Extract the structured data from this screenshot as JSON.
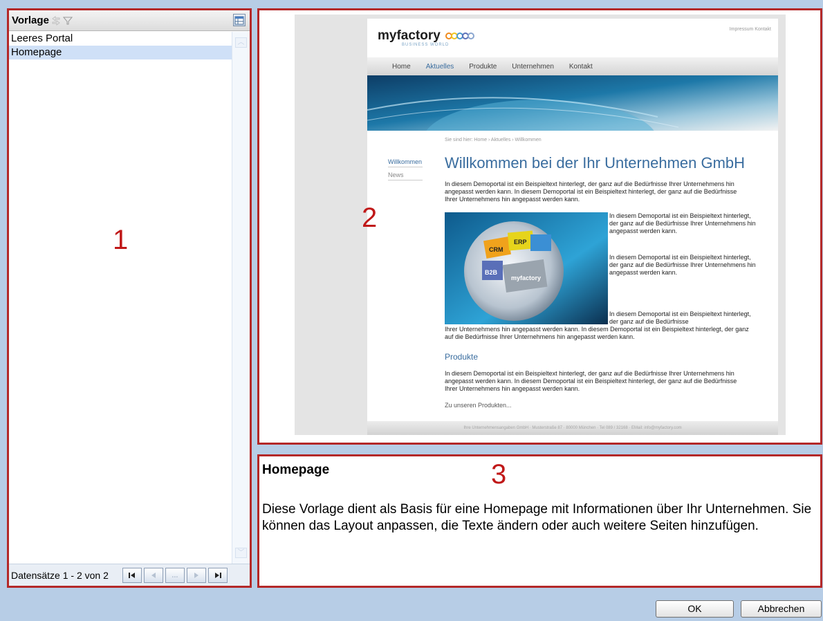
{
  "list_panel": {
    "header_title": "Vorlage",
    "rows": [
      {
        "label": "Leeres Portal",
        "selected": false
      },
      {
        "label": "Homepage",
        "selected": true
      }
    ],
    "record_count": "Datensätze 1 - 2 von 2",
    "nav_buttons": [
      "first",
      "previous",
      "...",
      "next",
      "last"
    ],
    "ellipsis_label": "...",
    "number_label": "1"
  },
  "preview_panel": {
    "number_label": "2",
    "site": {
      "logo_brand": "myfactory",
      "logo_sub": "BUSINESS WORLD",
      "top_links": "Impressum Kontakt",
      "nav": [
        "Home",
        "Aktuelles",
        "Produkte",
        "Unternehmen",
        "Kontakt"
      ],
      "nav_active": "Aktuelles",
      "breadcrumb": "Sie sind hier: Home › Aktuelles › Willkommen",
      "side_nav": [
        "Willkommen",
        "News"
      ],
      "heading": "Willkommen bei der Ihr Unternehmen GmbH",
      "paragraph_1": "In diesem Demoportal ist ein Beispieltext hinterlegt, der ganz auf die Bedürfnisse Ihrer Unternehmens hin angepasst werden kann. In diesem Demoportal ist ein Beispieltext hinterlegt, der ganz auf die Bedürfnisse Ihrer Unternehmens hin angepasst werden kann.",
      "paragraph_2": "In diesem Demoportal ist ein Beispieltext hinterlegt, der ganz auf die Bedürfnisse Ihrer Unternehmens hin angepasst werden kann.",
      "paragraph_3": "In diesem Demoportal ist ein Beispieltext hinterlegt, der ganz auf die Bedürfnisse Ihrer Unternehmens hin angepasst werden kann.",
      "paragraph_4": "In diesem Demoportal ist ein Beispieltext hinterlegt, der ganz auf die Bedürfnisse",
      "paragraph_5": "Ihrer Unternehmens hin angepasst werden kann. In diesem Demoportal ist ein Beispieltext hinterlegt, der ganz auf die Bedürfnisse Ihrer Unternehmens hin angepasst werden kann.",
      "subheading": "Produkte",
      "paragraph_6": "In diesem Demoportal ist ein Beispieltext hinterlegt, der ganz auf die Bedürfnisse Ihrer Unternehmens hin angepasst werden kann. In diesem Demoportal ist ein Beispieltext hinterlegt, der ganz auf die Bedürfnisse Ihrer Unternehmens hin angepasst werden kann.",
      "more_link": "Zu unseren Produkten...",
      "footer": "Ihre Unternehmensangaben GmbH · Musterstraße 87 · 80000 München · Tel 089 / 32168 · EMail: info@myfactory.com",
      "image_labels": {
        "crm": "CRM",
        "erp": "ERP",
        "b2b": "B2B",
        "brand": "myfactory"
      }
    }
  },
  "description_panel": {
    "number_label": "3",
    "title": "Homepage",
    "text": "Diese Vorlage dient als Basis für eine Homepage mit Informationen über Ihr Unternehmen. Sie können das Layout anpassen, die Texte ändern oder auch weitere Seiten hinzufügen."
  },
  "buttons": {
    "ok": "OK",
    "cancel": "Abbrechen"
  },
  "colors": {
    "background": "#b7cde6",
    "panel_border": "#b42828",
    "selection": "#cfe0f7",
    "site_accent": "#3a6d9f"
  },
  "icons": {
    "header": [
      "sort-icon",
      "filter-icon"
    ],
    "export": "export-icon"
  }
}
